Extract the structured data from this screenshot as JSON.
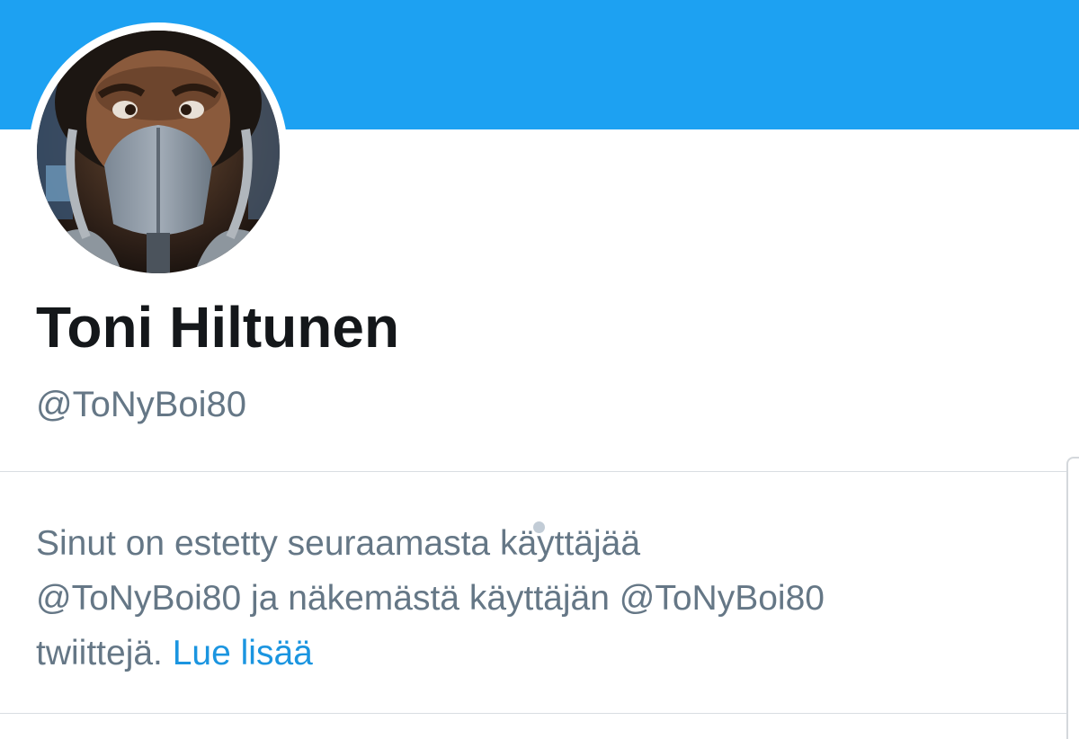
{
  "profile": {
    "display_name": "Toni Hiltunen",
    "handle": "@ToNyBoi80",
    "avatar_icon": "profile-photo"
  },
  "notice": {
    "line1": "Sinut on estetty seuraamasta käyttäjää",
    "line2": "@ToNyBoi80 ja näkemästä käyttäjän @ToNyBoi80",
    "line3_prefix": "twiittejä.",
    "link_label": "Lue lisää"
  },
  "colors": {
    "banner": "#1da1f2",
    "name": "#14171a",
    "secondary_text": "#657786",
    "link": "#1b95e0"
  }
}
